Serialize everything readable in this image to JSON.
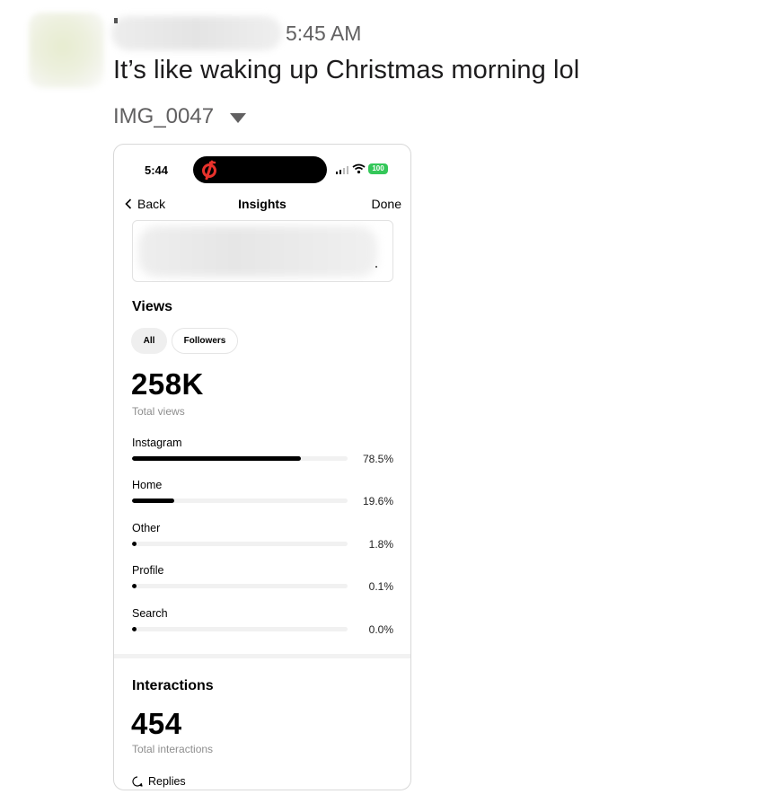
{
  "message": {
    "timestamp": "5:45 AM",
    "text": "It’s like waking up Christmas morning lol",
    "attachment_name": "IMG_0047"
  },
  "screenshot": {
    "status_bar": {
      "time": "5:44",
      "battery": "100"
    },
    "nav": {
      "back_label": "Back",
      "title": "Insights",
      "done_label": "Done"
    },
    "views": {
      "title": "Views",
      "filters": [
        "All",
        "Followers"
      ],
      "total": "258K",
      "total_label": "Total views",
      "sources": [
        {
          "label": "Instagram",
          "percent_text": "78.5%",
          "value": 78.5
        },
        {
          "label": "Home",
          "percent_text": "19.6%",
          "value": 19.6
        },
        {
          "label": "Other",
          "percent_text": "1.8%",
          "value": 1.8
        },
        {
          "label": "Profile",
          "percent_text": "0.1%",
          "value": 0.1
        },
        {
          "label": "Search",
          "percent_text": "0.0%",
          "value": 0.0
        }
      ]
    },
    "interactions": {
      "title": "Interactions",
      "total": "454",
      "total_label": "Total interactions",
      "replies_label": "Replies"
    }
  },
  "colors": {
    "battery_green": "#34c759",
    "logo_red": "#e8322c",
    "bar_fill": "#000000",
    "bar_track": "#f1f1f1",
    "muted_text": "#616061"
  },
  "icons": [
    "chevron-left-icon",
    "peloton-logo-icon",
    "signal-icon",
    "wifi-icon",
    "battery-icon",
    "caret-down-icon",
    "reply-bubble-icon"
  ]
}
